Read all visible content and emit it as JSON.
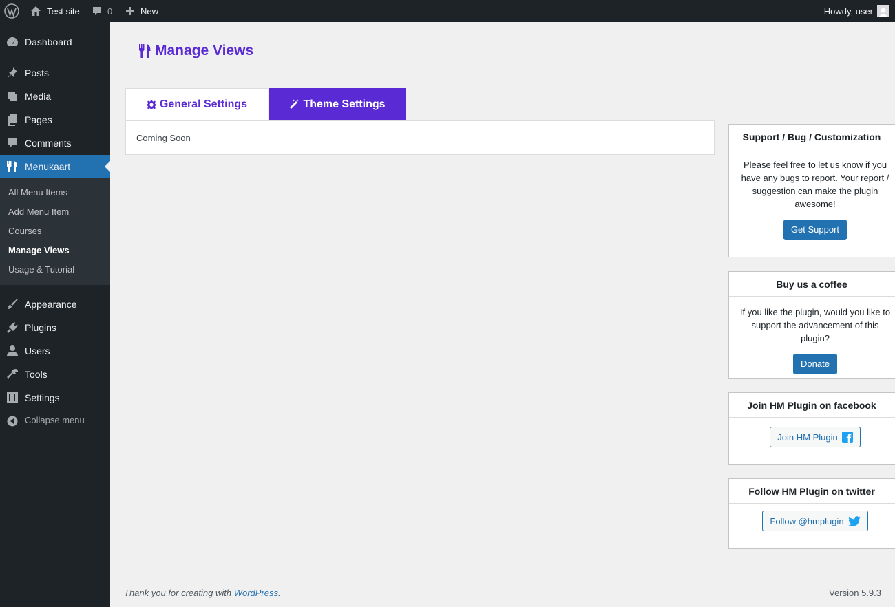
{
  "adminbar": {
    "site_name": "Test site",
    "comments_count": "0",
    "new_label": "New",
    "howdy": "Howdy, user"
  },
  "sidebar": {
    "items": [
      {
        "label": "Dashboard",
        "icon": "dashboard-icon"
      },
      {
        "label": "Posts",
        "icon": "pin-icon"
      },
      {
        "label": "Media",
        "icon": "media-icon"
      },
      {
        "label": "Pages",
        "icon": "pages-icon"
      },
      {
        "label": "Comments",
        "icon": "comment-icon"
      },
      {
        "label": "Menukaart",
        "icon": "utensils-icon",
        "current": true
      },
      {
        "label": "Appearance",
        "icon": "brush-icon"
      },
      {
        "label": "Plugins",
        "icon": "plug-icon"
      },
      {
        "label": "Users",
        "icon": "user-icon"
      },
      {
        "label": "Tools",
        "icon": "wrench-icon"
      },
      {
        "label": "Settings",
        "icon": "sliders-icon"
      }
    ],
    "submenu": [
      "All Menu Items",
      "Add Menu Item",
      "Courses",
      "Manage Views",
      "Usage & Tutorial"
    ],
    "submenu_current": "Manage Views",
    "collapse_label": "Collapse menu"
  },
  "main": {
    "title": "Manage Views",
    "tabs": [
      {
        "label": "General Settings",
        "icon": "gear-icon"
      },
      {
        "label": "Theme Settings",
        "icon": "magic-wand-icon",
        "active": true
      }
    ],
    "content_text": "Coming Soon"
  },
  "widgets": {
    "support": {
      "title": "Support / Bug / Customization",
      "text": "Please feel free to let us know if you have any bugs to report. Your report / suggestion can make the plugin awesome!",
      "button": "Get Support"
    },
    "coffee": {
      "title": "Buy us a coffee",
      "text": "If you like the plugin, would you like to support the advancement of this plugin?",
      "button": "Donate"
    },
    "facebook": {
      "title": "Join HM Plugin on facebook",
      "button": "Join HM Plugin"
    },
    "twitter": {
      "title": "Follow HM Plugin on twitter",
      "button": "Follow @hmplugin"
    }
  },
  "footer": {
    "thanks_prefix": "Thank you for creating with ",
    "thanks_link": "WordPress",
    "thanks_suffix": ".",
    "version": "Version 5.9.3"
  },
  "colors": {
    "accent": "#5a2bd4",
    "wp_blue": "#2271b1",
    "admin_dark": "#1d2327",
    "facebook": "#1877f2",
    "twitter": "#1da1f2"
  }
}
